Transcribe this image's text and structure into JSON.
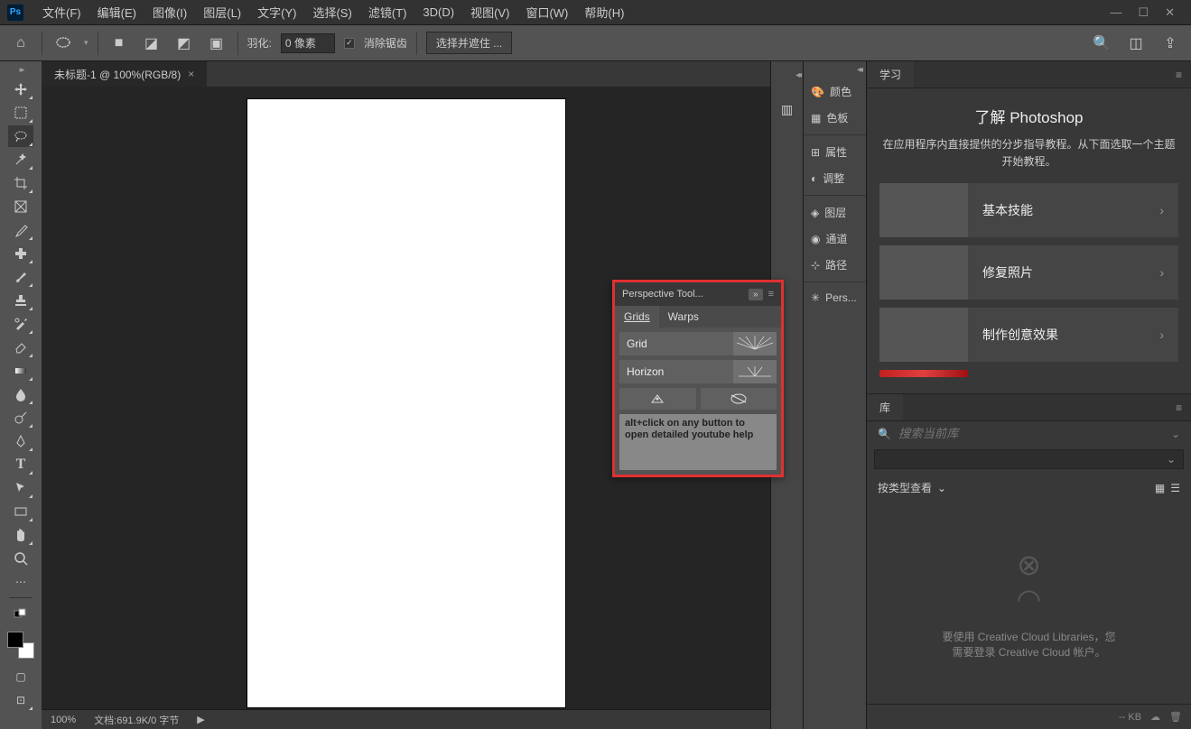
{
  "app_logo": "Ps",
  "menu": [
    "文件(F)",
    "编辑(E)",
    "图像(I)",
    "图层(L)",
    "文字(Y)",
    "选择(S)",
    "滤镜(T)",
    "3D(D)",
    "视图(V)",
    "窗口(W)",
    "帮助(H)"
  ],
  "options": {
    "feather_label": "羽化:",
    "feather_value": "0 像素",
    "antialias": "消除锯齿",
    "select_mask": "选择并遮住 ..."
  },
  "doc_tab": "未标题-1 @ 100%(RGB/8)",
  "status": {
    "zoom": "100%",
    "info": "文档:691.9K/0 字节",
    "arrow": "▶"
  },
  "panel_strip": [
    {
      "icon": "🎨",
      "label": "颜色"
    },
    {
      "icon": "▦",
      "label": "色板"
    },
    {
      "icon": "⊞",
      "label": "属性"
    },
    {
      "icon": "◐",
      "label": "调整"
    },
    {
      "icon": "◈",
      "label": "图层"
    },
    {
      "icon": "◉",
      "label": "通道"
    },
    {
      "icon": "⊹",
      "label": "路径"
    },
    {
      "icon": "✳",
      "label": "Pers..."
    }
  ],
  "learn": {
    "tab": "学习",
    "title": "了解 Photoshop",
    "desc": "在应用程序内直接提供的分步指导教程。从下面选取一个主题开始教程。",
    "tutorials": [
      "基本技能",
      "修复照片",
      "制作创意效果"
    ]
  },
  "library": {
    "tab": "库",
    "search_placeholder": "搜索当前库",
    "view_label": "按类型查看",
    "empty1": "要使用 Creative Cloud Libraries，您",
    "empty2": "需要登录 Creative Cloud 帐户。",
    "footer_kb": "-- KB"
  },
  "perspective": {
    "title": "Perspective Tool...",
    "tabs": [
      "Grids",
      "Warps"
    ],
    "rows": [
      "Grid",
      "Horizon"
    ],
    "help": "alt+click on any button to open detailed youtube help"
  },
  "tools": [
    "move",
    "marquee",
    "lasso",
    "magic",
    "crop",
    "frame",
    "eyedrop",
    "heal",
    "brush",
    "stamp",
    "history",
    "eraser",
    "gradient",
    "blur",
    "dodge",
    "pen",
    "type",
    "path",
    "rect",
    "hand",
    "zoom",
    "more"
  ]
}
